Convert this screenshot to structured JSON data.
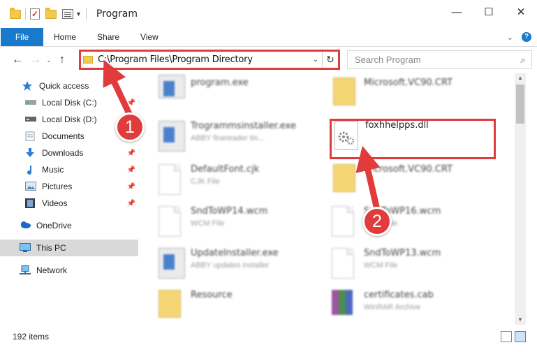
{
  "window": {
    "title": "Program",
    "minimize": "—",
    "maximize": "☐",
    "close": "✕"
  },
  "ribbon": {
    "tabs": [
      "File",
      "Home",
      "Share",
      "View"
    ],
    "expand": "⌄",
    "help": "?"
  },
  "nav": {
    "back": "←",
    "forward": "→",
    "recent": "⌄",
    "up": "↑",
    "address": "C:\\Program Files\\Program Directory",
    "address_drop": "⌄",
    "refresh": "↻",
    "search_placeholder": "Search Program",
    "search_icon": "⌕"
  },
  "sidebar": {
    "items": [
      {
        "label": "Quick access",
        "icon": "star-icon",
        "pinned": false
      },
      {
        "label": "Local Disk (C:)",
        "icon": "drive-icon",
        "pinned": true
      },
      {
        "label": "Local Disk (D:)",
        "icon": "drive-icon",
        "pinned": true
      },
      {
        "label": "Documents",
        "icon": "documents-icon",
        "pinned": true
      },
      {
        "label": "Downloads",
        "icon": "download-icon",
        "pinned": true
      },
      {
        "label": "Music",
        "icon": "music-icon",
        "pinned": true
      },
      {
        "label": "Pictures",
        "icon": "pictures-icon",
        "pinned": true
      },
      {
        "label": "Videos",
        "icon": "videos-icon",
        "pinned": true
      },
      {
        "label": "OneDrive",
        "icon": "cloud-icon",
        "pinned": false
      },
      {
        "label": "This PC",
        "icon": "computer-icon",
        "pinned": false,
        "selected": true
      },
      {
        "label": "Network",
        "icon": "network-icon",
        "pinned": false
      }
    ],
    "pin_glyph": "📌"
  },
  "files": [
    {
      "name": "program.exe",
      "sub": "",
      "icon": "exe-icon"
    },
    {
      "name": "Microsoft.VC90.CRT",
      "sub": "",
      "icon": "folder-icon"
    },
    {
      "name": "Trogrammsinstaller.exe",
      "sub": "ABBY finereader tin...",
      "icon": "exe-icon"
    },
    {
      "name": "foxhhelpps.dll",
      "sub": "",
      "icon": "dll-icon"
    },
    {
      "name": "DefaultFont.cjk",
      "sub": "CJK File",
      "icon": "doc-icon"
    },
    {
      "name": "Microsoft.VC90.CRT",
      "sub": "",
      "icon": "folder-icon"
    },
    {
      "name": "SndToWP14.wcm",
      "sub": "WCM File",
      "icon": "doc-icon"
    },
    {
      "name": "SndToWP16.wcm",
      "sub": "WCM File",
      "icon": "doc-icon"
    },
    {
      "name": "UpdateInstaller.exe",
      "sub": "ABBY updates installer",
      "icon": "exe-icon"
    },
    {
      "name": "SndToWP13.wcm",
      "sub": "WCM File",
      "icon": "doc-icon"
    },
    {
      "name": "Resource",
      "sub": "",
      "icon": "folder-icon"
    },
    {
      "name": "certificates.cab",
      "sub": "WinRAR Archive",
      "icon": "rar-icon"
    }
  ],
  "status": {
    "count": "192 items"
  },
  "annotations": {
    "step1": "1",
    "step2": "2"
  },
  "colors": {
    "accent": "#1979ca",
    "annotation": "#e03c3c"
  }
}
